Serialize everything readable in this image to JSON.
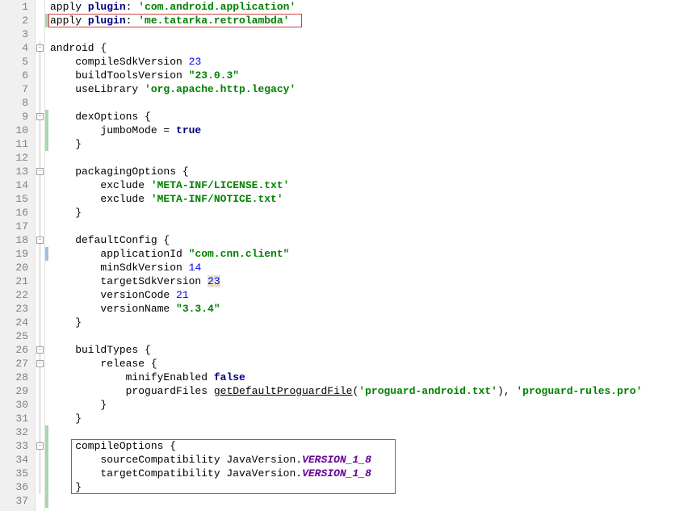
{
  "lines": [
    {
      "n": "1",
      "tokens": [
        {
          "t": "apply ",
          "c": "ident"
        },
        {
          "t": "plugin",
          "c": "kw"
        },
        {
          "t": ": ",
          "c": "ident"
        },
        {
          "t": "'com.android.application'",
          "c": "str"
        }
      ]
    },
    {
      "n": "2",
      "tokens": [
        {
          "t": "apply ",
          "c": "ident"
        },
        {
          "t": "plugin",
          "c": "kw"
        },
        {
          "t": ": ",
          "c": "ident"
        },
        {
          "t": "'me.tatarka.retrolambda'",
          "c": "str"
        }
      ]
    },
    {
      "n": "3",
      "tokens": []
    },
    {
      "n": "4",
      "tokens": [
        {
          "t": "android {",
          "c": "ident"
        }
      ]
    },
    {
      "n": "5",
      "tokens": [
        {
          "t": "    compileSdkVersion ",
          "c": "ident"
        },
        {
          "t": "23",
          "c": "num"
        }
      ]
    },
    {
      "n": "6",
      "tokens": [
        {
          "t": "    buildToolsVersion ",
          "c": "ident"
        },
        {
          "t": "\"23.0.3\"",
          "c": "str"
        }
      ]
    },
    {
      "n": "7",
      "tokens": [
        {
          "t": "    useLibrary ",
          "c": "ident"
        },
        {
          "t": "'org.apache.http.legacy'",
          "c": "str"
        }
      ]
    },
    {
      "n": "8",
      "tokens": []
    },
    {
      "n": "9",
      "tokens": [
        {
          "t": "    dexOptions {",
          "c": "ident"
        }
      ]
    },
    {
      "n": "10",
      "tokens": [
        {
          "t": "        jumboMode = ",
          "c": "ident"
        },
        {
          "t": "true",
          "c": "kw"
        }
      ]
    },
    {
      "n": "11",
      "tokens": [
        {
          "t": "    }",
          "c": "ident"
        }
      ]
    },
    {
      "n": "12",
      "tokens": []
    },
    {
      "n": "13",
      "tokens": [
        {
          "t": "    packagingOptions {",
          "c": "ident"
        }
      ]
    },
    {
      "n": "14",
      "tokens": [
        {
          "t": "        exclude ",
          "c": "ident"
        },
        {
          "t": "'META-INF/LICENSE.txt'",
          "c": "str"
        }
      ]
    },
    {
      "n": "15",
      "tokens": [
        {
          "t": "        exclude ",
          "c": "ident"
        },
        {
          "t": "'META-INF/NOTICE.txt'",
          "c": "str"
        }
      ]
    },
    {
      "n": "16",
      "tokens": [
        {
          "t": "    }",
          "c": "ident"
        }
      ]
    },
    {
      "n": "17",
      "tokens": []
    },
    {
      "n": "18",
      "tokens": [
        {
          "t": "    defaultConfig {",
          "c": "ident"
        }
      ]
    },
    {
      "n": "19",
      "tokens": [
        {
          "t": "        applicationId ",
          "c": "ident"
        },
        {
          "t": "\"com.cnn.client\"",
          "c": "str"
        }
      ]
    },
    {
      "n": "20",
      "tokens": [
        {
          "t": "        minSdkVersion ",
          "c": "ident"
        },
        {
          "t": "14",
          "c": "num"
        }
      ]
    },
    {
      "n": "21",
      "tokens": [
        {
          "t": "        targetSdkVersion ",
          "c": "ident"
        },
        {
          "t": "23",
          "c": "num highlight-box"
        }
      ]
    },
    {
      "n": "22",
      "tokens": [
        {
          "t": "        versionCode ",
          "c": "ident"
        },
        {
          "t": "21",
          "c": "num"
        }
      ]
    },
    {
      "n": "23",
      "tokens": [
        {
          "t": "        versionName ",
          "c": "ident"
        },
        {
          "t": "\"3.3.4\"",
          "c": "str"
        }
      ]
    },
    {
      "n": "24",
      "tokens": [
        {
          "t": "    }",
          "c": "ident"
        }
      ]
    },
    {
      "n": "25",
      "tokens": []
    },
    {
      "n": "26",
      "tokens": [
        {
          "t": "    buildTypes {",
          "c": "ident"
        }
      ]
    },
    {
      "n": "27",
      "tokens": [
        {
          "t": "        release {",
          "c": "ident"
        }
      ]
    },
    {
      "n": "28",
      "tokens": [
        {
          "t": "            minifyEnabled ",
          "c": "ident"
        },
        {
          "t": "false",
          "c": "kw"
        }
      ]
    },
    {
      "n": "29",
      "tokens": [
        {
          "t": "            proguardFiles ",
          "c": "ident"
        },
        {
          "t": "getDefaultProguardFile",
          "c": "ident underline"
        },
        {
          "t": "(",
          "c": "ident"
        },
        {
          "t": "'proguard-android.txt'",
          "c": "str"
        },
        {
          "t": "), ",
          "c": "ident"
        },
        {
          "t": "'proguard-rules.pro'",
          "c": "str"
        }
      ]
    },
    {
      "n": "30",
      "tokens": [
        {
          "t": "        }",
          "c": "ident"
        }
      ]
    },
    {
      "n": "31",
      "tokens": [
        {
          "t": "    }",
          "c": "ident"
        }
      ]
    },
    {
      "n": "32",
      "tokens": []
    },
    {
      "n": "33",
      "tokens": [
        {
          "t": "    compileOptions {",
          "c": "ident"
        }
      ]
    },
    {
      "n": "34",
      "tokens": [
        {
          "t": "        sourceCompatibility JavaVersion.",
          "c": "ident"
        },
        {
          "t": "VERSION_1_8",
          "c": "purple-italic"
        }
      ]
    },
    {
      "n": "35",
      "tokens": [
        {
          "t": "        targetCompatibility JavaVersion.",
          "c": "ident"
        },
        {
          "t": "VERSION_1_8",
          "c": "purple-italic"
        }
      ]
    },
    {
      "n": "36",
      "tokens": [
        {
          "t": "    }",
          "c": "ident"
        }
      ]
    },
    {
      "n": "37",
      "tokens": []
    }
  ],
  "changeMarks": {
    "2": "green",
    "9": "green",
    "10": "green",
    "11": "green",
    "19": "blue",
    "32": "green",
    "33": "green",
    "34": "green",
    "35": "green",
    "36": "green",
    "37": "green"
  }
}
